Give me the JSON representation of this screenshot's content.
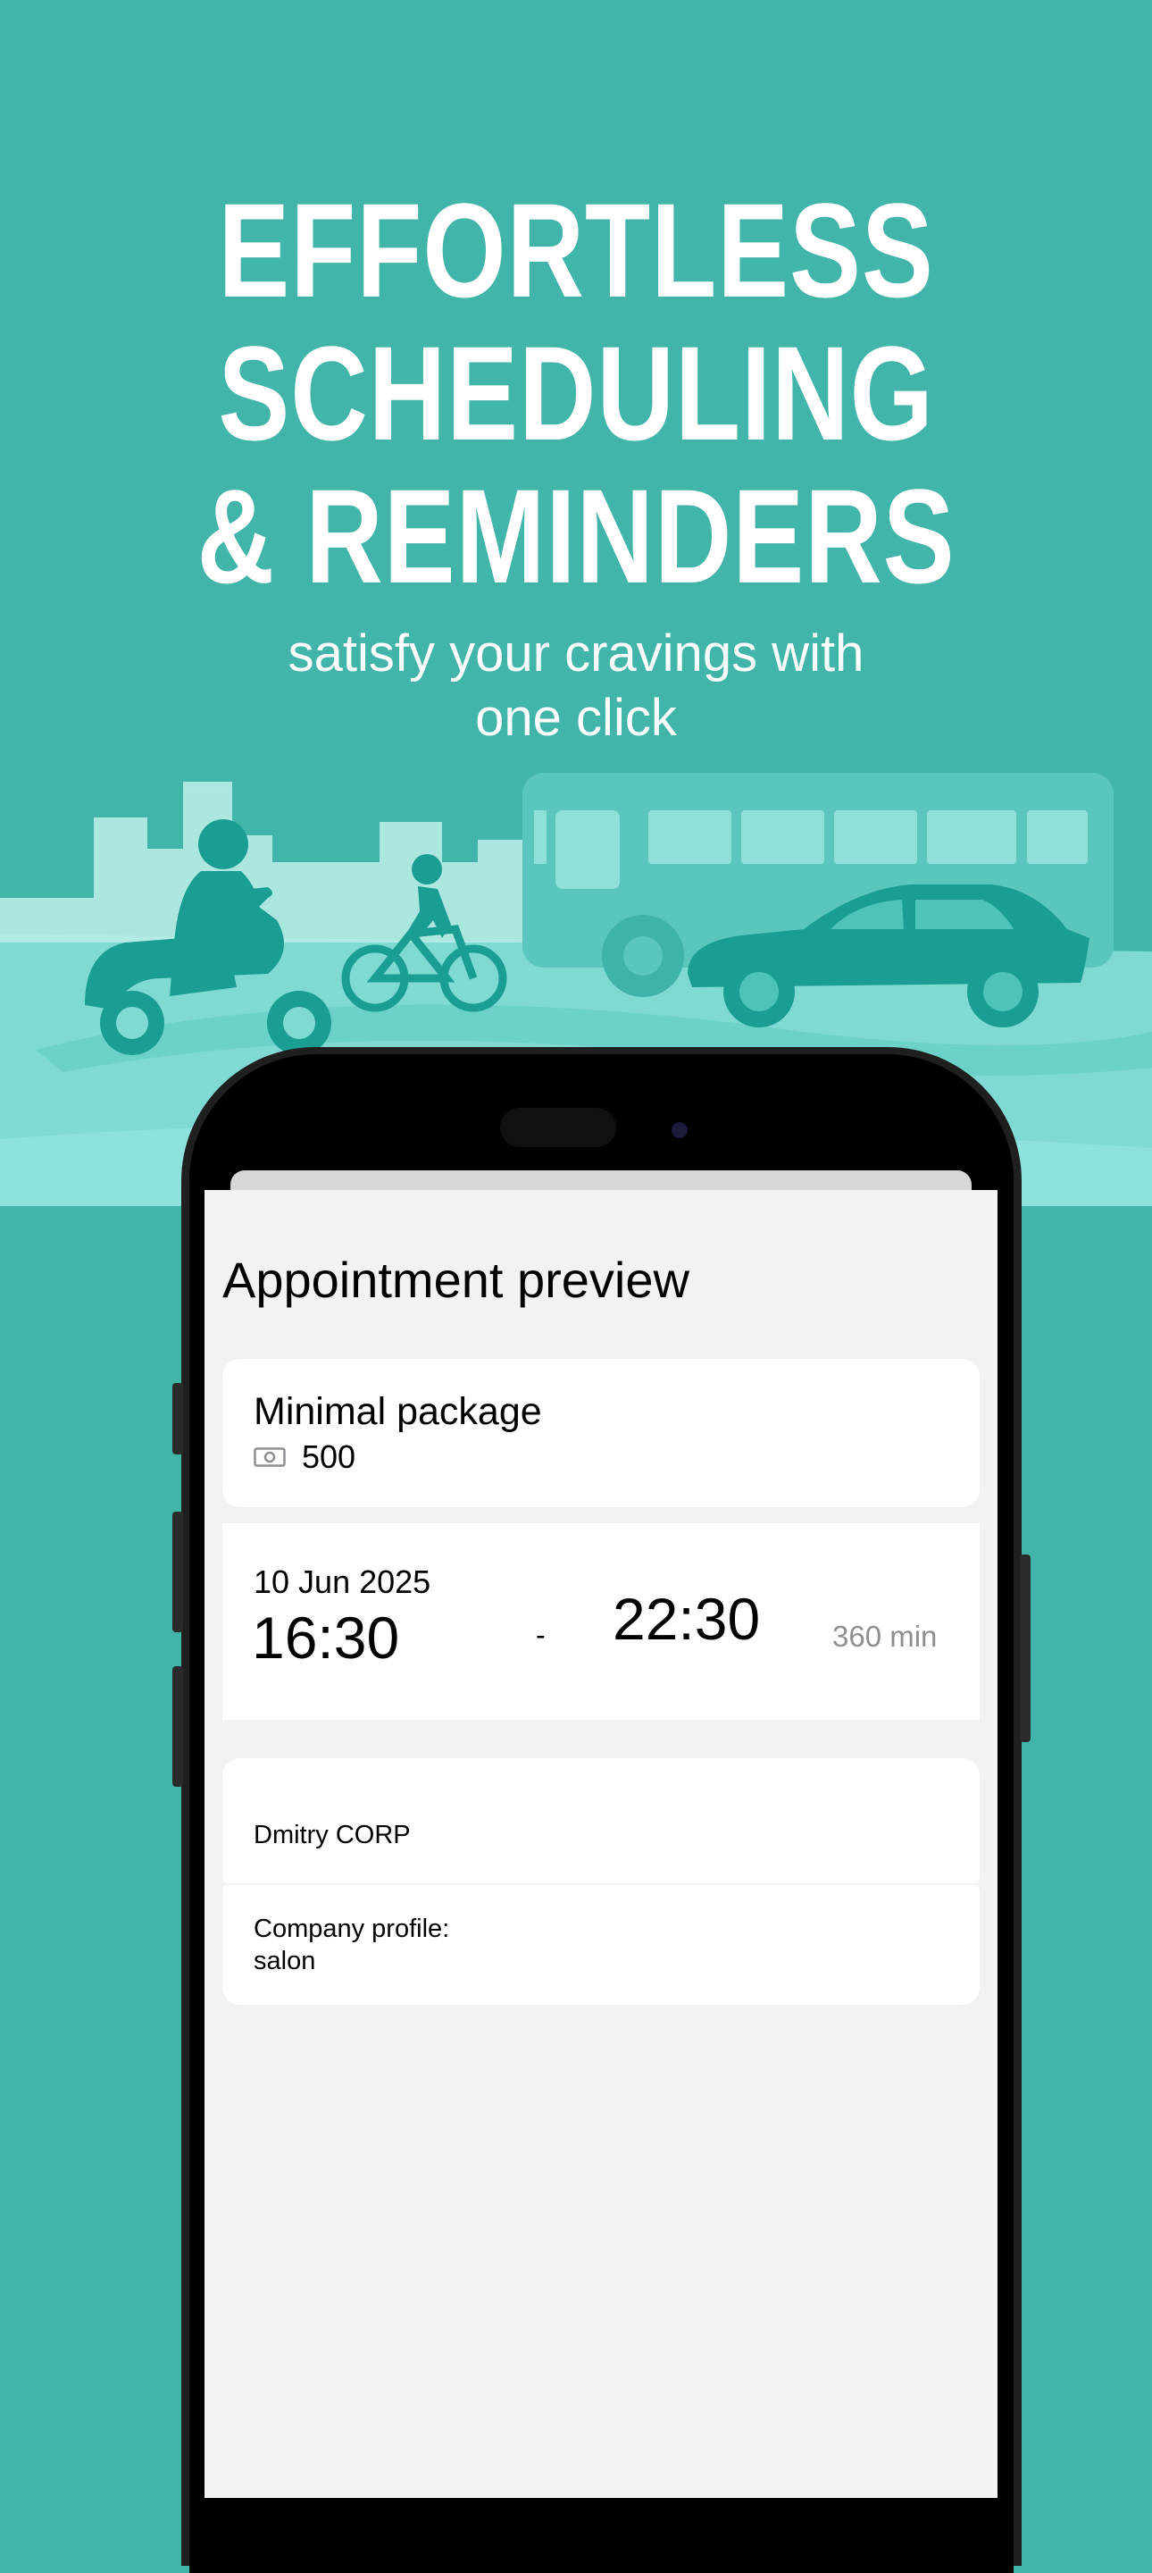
{
  "hero": {
    "title_lines": [
      "EFFORTLESS",
      "SCHEDULING",
      "& REMINDERS"
    ],
    "subtitle_line1": "satisfy your cravings with",
    "subtitle_line2": "one click"
  },
  "colors": {
    "background": "#42b5ab",
    "illustration_dark": "#1a9e94",
    "illustration_light": "#7fdad3",
    "screen_background": "#f2f2f2",
    "card_background": "#ffffff",
    "secondary_text": "#8e8e93"
  },
  "screen": {
    "title": "Appointment preview",
    "package": {
      "name": "Minimal package",
      "price_icon": "banknote-icon",
      "price": "500"
    },
    "schedule": {
      "date": "10 Jun 2025",
      "start_time": "16:30",
      "separator": "-",
      "end_time": "22:30",
      "duration": "360 min"
    },
    "company": {
      "name": "Dmitry CORP",
      "profile_label": "Company profile:",
      "profile_value": "salon"
    }
  }
}
